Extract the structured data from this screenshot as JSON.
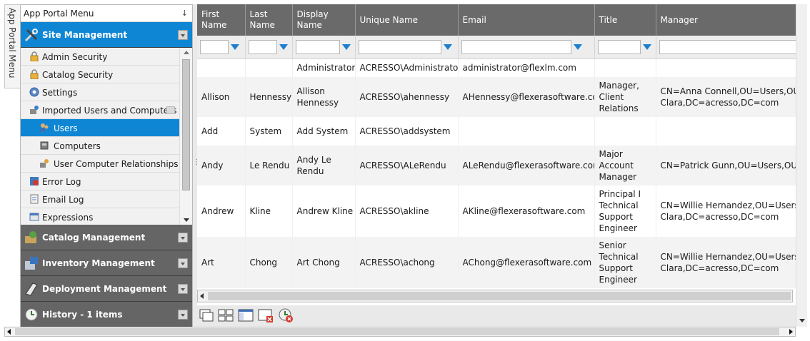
{
  "side_tab": {
    "label": "App Portal Menu"
  },
  "menu": {
    "title": "App Portal Menu",
    "pin_icon": "pin-icon",
    "sections": [
      {
        "label": "Site Management",
        "icon": "tools-icon",
        "expanded": true
      },
      {
        "label": "Catalog Management",
        "icon": "catalog-icon"
      },
      {
        "label": "Inventory Management",
        "icon": "inventory-icon"
      },
      {
        "label": "Deployment Management",
        "icon": "deployment-icon"
      },
      {
        "label": "History - 1 items",
        "icon": "history-icon"
      }
    ],
    "items": [
      {
        "label": "Admin Security",
        "icon": "lock-icon"
      },
      {
        "label": "Catalog Security",
        "icon": "lock-icon"
      },
      {
        "label": "Settings",
        "icon": "gear-icon"
      },
      {
        "label": "Imported Users and Computers",
        "icon": "users-computers-icon"
      },
      {
        "label": "Users",
        "icon": "users-icon",
        "selected": true
      },
      {
        "label": "Computers",
        "icon": "computer-icon"
      },
      {
        "label": "User Computer Relationships",
        "icon": "relationship-icon"
      },
      {
        "label": "Error Log",
        "icon": "error-log-icon"
      },
      {
        "label": "Email Log",
        "icon": "email-log-icon"
      },
      {
        "label": "Expressions",
        "icon": "expressions-icon"
      }
    ]
  },
  "grid": {
    "columns": [
      "First Name",
      "Last Name",
      "Display Name",
      "Unique Name",
      "Email",
      "Title",
      "Manager"
    ],
    "rows": [
      [
        "",
        "",
        "Administrator",
        "ACRESSO\\Administrator",
        "administrator@flexlm.com",
        "",
        ""
      ],
      [
        "Allison",
        "Hennessy",
        "Allison Hennessy",
        "ACRESSO\\ahennessy",
        "AHennessy@flexerasoftware.com",
        "Manager, Client Relations",
        "CN=Anna Connell,OU=Users,OU=Santa Clara,DC=acresso,DC=com"
      ],
      [
        "Add",
        "System",
        "Add System",
        "ACRESSO\\addsystem",
        "",
        "",
        ""
      ],
      [
        "Andy",
        "Le Rendu",
        "Andy Le Rendu",
        "ACRESSO\\ALeRendu",
        "ALeRendu@flexerasoftware.com",
        "Major Account Manager",
        "CN=Patrick Gunn,OU=Users,OU=Maidenhead,DC="
      ],
      [
        "Andrew",
        "Kline",
        "Andrew Kline",
        "ACRESSO\\akline",
        "AKline@flexerasoftware.com",
        "Principal I Technical Support Engineer",
        "CN=Willie Hernandez,OU=Users,OU=Santa Clara,DC=acresso,DC=com"
      ],
      [
        "Art",
        "Chong",
        "Art Chong",
        "ACRESSO\\achong",
        "AChong@flexerasoftware.com",
        "Senior Technical Support Engineer",
        "CN=Willie Hernandez,OU=Users,OU=Santa Clara,DC=acresso,DC=com"
      ]
    ]
  },
  "toolbar": {
    "buttons": [
      "cascade-windows-icon",
      "tile-windows-icon",
      "layout-icon",
      "close-window-icon",
      "clear-cache-icon"
    ]
  }
}
